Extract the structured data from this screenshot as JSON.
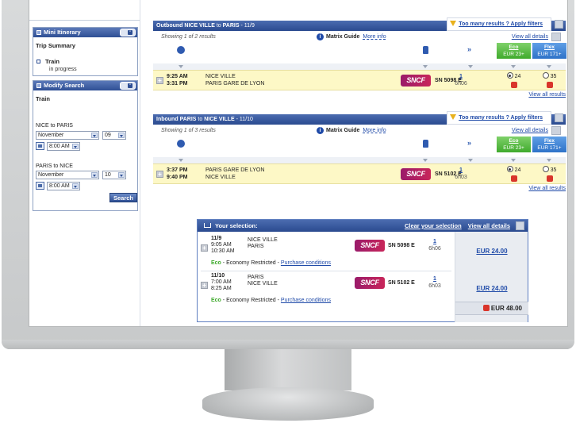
{
  "sidebar": {
    "itinerary": {
      "title": "Mini Itinerary",
      "trip_summary": "Trip Summary",
      "item": "Train",
      "status": "in progress"
    },
    "modify": {
      "title": "Modify Search",
      "mode": "Train",
      "outbound_label": "NICE to PARIS",
      "outbound_month": "November",
      "outbound_day": "09",
      "outbound_time": "8:00 AM",
      "inbound_label": "PARIS to NICE",
      "inbound_month": "November",
      "inbound_day": "10",
      "inbound_time": "8:00 AM",
      "search_label": "Search"
    }
  },
  "outbound": {
    "header_prefix": "Outbound",
    "from": "NICE VILLE",
    "to_word": "to",
    "to": "PARIS",
    "date": "- 11/9",
    "showing": "Showing  1  of  2  results",
    "filters": "Too many results ? Apply filters",
    "view_all_details": "View all details",
    "view_all_results": "View all results",
    "dep_time": "9:25 AM",
    "arr_time": "3:31 PM",
    "dep_station": "NICE VILLE",
    "arr_station": "PARIS GARE DE LYON",
    "operator": "SNCF",
    "train_no": "SN 5098 E",
    "changes": "1",
    "duration": "6h06",
    "eco_seats": "24",
    "flex_seats": "35"
  },
  "inbound": {
    "header_prefix": "Inbound",
    "from": "PARIS",
    "to_word": "to",
    "to": "NICE VILLE",
    "date": "- 11/10",
    "showing": "Showing  1  of  3  results",
    "filters": "Too many results ? Apply filters",
    "view_all_details": "View all details",
    "view_all_results": "View all results",
    "dep_time": "3:37 PM",
    "arr_time": "9:40 PM",
    "dep_station": "PARIS GARE DE LYON",
    "arr_station": "NICE VILLE",
    "operator": "SNCF",
    "train_no": "SN 5102 E",
    "changes": "1",
    "duration": "6h03",
    "eco_seats": "24",
    "flex_seats": "35"
  },
  "common": {
    "matrix_guide": "Matrix Guide",
    "more_info": "More info",
    "eco_title": "Eco",
    "eco_price": "EUR 23+",
    "flex_title": "Flex",
    "flex_price": "EUR 171+"
  },
  "selection": {
    "title": "Your selection:",
    "clear": "Clear your selection",
    "view_all": "View all details",
    "legs": [
      {
        "date": "11/9",
        "dep": "9:05 AM",
        "arr": "10:30 AM",
        "from": "NICE VILLE",
        "to": "PARIS",
        "train_no": "SN 5098 E",
        "changes": "1",
        "duration": "6h06",
        "fare_class": "Eco",
        "fare_desc": " - Economy Restricted - ",
        "conditions": "Purchase conditions",
        "price": "EUR 24.00"
      },
      {
        "date": "11/10",
        "dep": "7:00 AM",
        "arr": "8:25 AM",
        "from": "PARIS",
        "to": "NICE VILLE",
        "train_no": "SN 5102 E",
        "changes": "1",
        "duration": "6h03",
        "fare_class": "Eco",
        "fare_desc": " - Economy Restricted - ",
        "conditions": "Purchase conditions",
        "price": "EUR 24.00"
      }
    ],
    "total": "EUR 48.00"
  }
}
